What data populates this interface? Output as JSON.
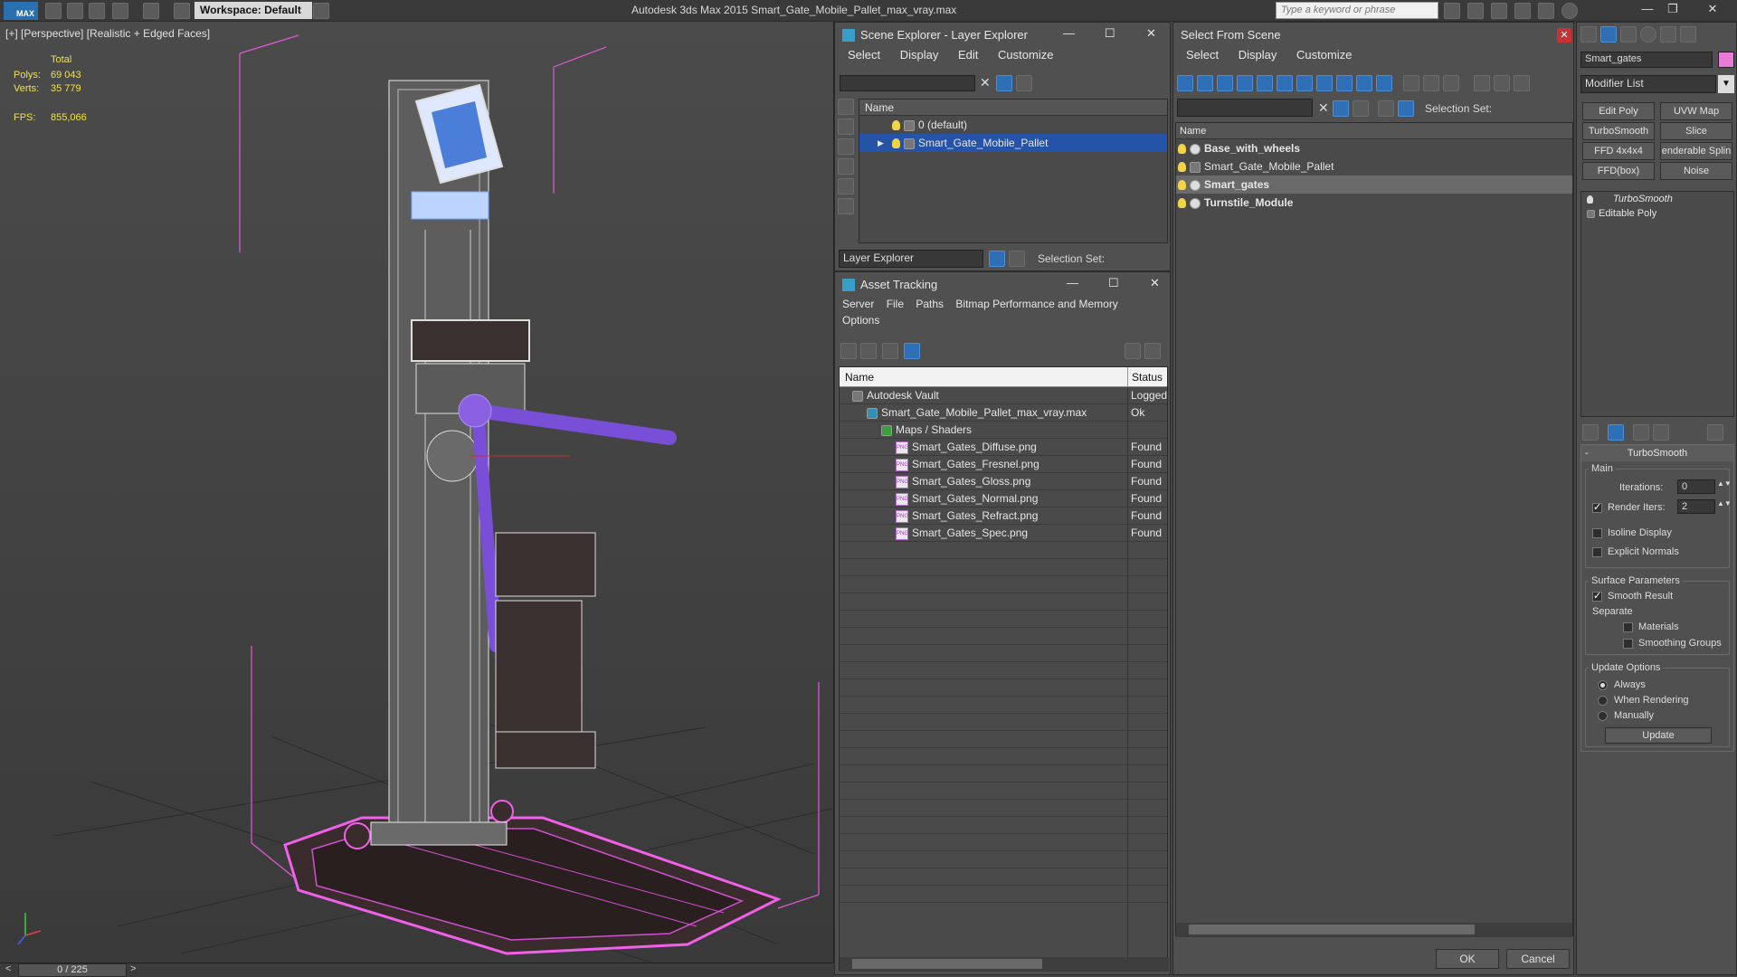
{
  "titlebar": {
    "logo": "MAX",
    "workspace_label": "Workspace: Default",
    "app_title": "Autodesk 3ds Max  2015    Smart_Gate_Mobile_Pallet_max_vray.max",
    "search_placeholder": "Type a keyword or phrase"
  },
  "viewport": {
    "label": "[+] [Perspective] [Realistic + Edged Faces]",
    "stats_header": "Total",
    "polys_label": "Polys:",
    "polys_value": "69 043",
    "verts_label": "Verts:",
    "verts_value": "35 779",
    "fps_label": "FPS:",
    "fps_value": "855,066"
  },
  "timeline": {
    "prev": "<",
    "frame": "0 / 225",
    "next": ">"
  },
  "scene_explorer": {
    "title": "Scene Explorer - Layer Explorer",
    "menu": [
      "Select",
      "Display",
      "Edit",
      "Customize"
    ],
    "column_name": "Name",
    "layers": [
      "0 (default)",
      "Smart_Gate_Mobile_Pallet"
    ],
    "footer_mode": "Layer Explorer",
    "footer_selection": "Selection Set:"
  },
  "asset_tracking": {
    "title": "Asset Tracking",
    "menu": [
      "Server",
      "File",
      "Paths",
      "Bitmap Performance and Memory"
    ],
    "menu2": "Options",
    "col_name": "Name",
    "col_status": "Status",
    "rows": [
      {
        "name": "Autodesk Vault",
        "status": "Logged",
        "indent": 0
      },
      {
        "name": "Smart_Gate_Mobile_Pallet_max_vray.max",
        "status": "Ok",
        "indent": 1
      },
      {
        "name": "Maps / Shaders",
        "status": "",
        "indent": 2
      },
      {
        "name": "Smart_Gates_Diffuse.png",
        "status": "Found",
        "indent": 3
      },
      {
        "name": "Smart_Gates_Fresnel.png",
        "status": "Found",
        "indent": 3
      },
      {
        "name": "Smart_Gates_Gloss.png",
        "status": "Found",
        "indent": 3
      },
      {
        "name": "Smart_Gates_Normal.png",
        "status": "Found",
        "indent": 3
      },
      {
        "name": "Smart_Gates_Refract.png",
        "status": "Found",
        "indent": 3
      },
      {
        "name": "Smart_Gates_Spec.png",
        "status": "Found",
        "indent": 3
      }
    ]
  },
  "select_from_scene": {
    "title": "Select From Scene",
    "menu": [
      "Select",
      "Display",
      "Customize"
    ],
    "selection_set": "Selection Set:",
    "column_name": "Name",
    "objects": [
      "Base_with_wheels",
      "Smart_Gate_Mobile_Pallet",
      "Smart_gates",
      "Turnstile_Module"
    ],
    "ok": "OK",
    "cancel": "Cancel"
  },
  "command_panel": {
    "object_name": "Smart_gates",
    "modifier_list": "Modifier List",
    "buttons": [
      "Edit Poly",
      "UVW Map",
      "TurboSmooth",
      "Slice",
      "FFD 4x4x4",
      "enderable Splin",
      "FFD(box)",
      "Noise"
    ],
    "stack": [
      "TurboSmooth",
      "Editable Poly"
    ],
    "rollout_title": "TurboSmooth",
    "main_label": "Main",
    "iterations_label": "Iterations:",
    "iterations_value": "0",
    "render_iters_label": "Render Iters:",
    "render_iters_value": "2",
    "isoline": "Isoline Display",
    "explicit_normals": "Explicit Normals",
    "surface_params": "Surface Parameters",
    "smooth_result": "Smooth Result",
    "separate": "Separate",
    "materials": "Materials",
    "smoothing_groups": "Smoothing Groups",
    "update_options": "Update Options",
    "always": "Always",
    "when_rendering": "When Rendering",
    "manually": "Manually",
    "update_btn": "Update"
  }
}
